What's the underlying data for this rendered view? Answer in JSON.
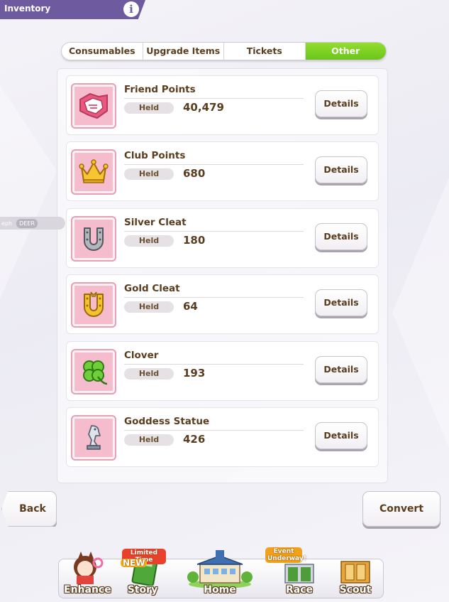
{
  "header": {
    "title": "Inventory",
    "info_icon_glyph": "i"
  },
  "tabs": [
    {
      "label": "Consumables",
      "active": false
    },
    {
      "label": "Upgrade Items",
      "active": false
    },
    {
      "label": "Tickets",
      "active": false
    },
    {
      "label": "Other",
      "active": true
    }
  ],
  "items": [
    {
      "name": "Friend Points",
      "held_label": "Held",
      "held_value": "40,479",
      "details_label": "Details",
      "icon": "handshake-icon"
    },
    {
      "name": "Club Points",
      "held_label": "Held",
      "held_value": "680",
      "details_label": "Details",
      "icon": "crown-icon"
    },
    {
      "name": "Silver Cleat",
      "held_label": "Held",
      "held_value": "180",
      "details_label": "Details",
      "icon": "silver-horseshoe-icon"
    },
    {
      "name": "Gold Cleat",
      "held_label": "Held",
      "held_value": "64",
      "details_label": "Details",
      "icon": "gold-horseshoe-icon"
    },
    {
      "name": "Clover",
      "held_label": "Held",
      "held_value": "193",
      "details_label": "Details",
      "icon": "clover-icon"
    },
    {
      "name": "Goddess Statue",
      "held_label": "Held",
      "held_value": "426",
      "details_label": "Details",
      "icon": "statue-icon"
    }
  ],
  "side_tag": {
    "left_text": "eph",
    "deer_text": "DEER"
  },
  "buttons": {
    "back": "Back",
    "convert": "Convert"
  },
  "nav": [
    {
      "label": "Enhance"
    },
    {
      "label": "Story",
      "badge_top": "Limited Time",
      "badge_new": "NEW"
    },
    {
      "label": "Home"
    },
    {
      "label": "Race",
      "badge_top": "Event Underway!"
    },
    {
      "label": "Scout"
    }
  ],
  "colors": {
    "header_bg": "#6e5a9e",
    "active_tab": "#7ccd22",
    "icon_frame": "#f5bccd",
    "text_brown": "#5a3d1e"
  }
}
